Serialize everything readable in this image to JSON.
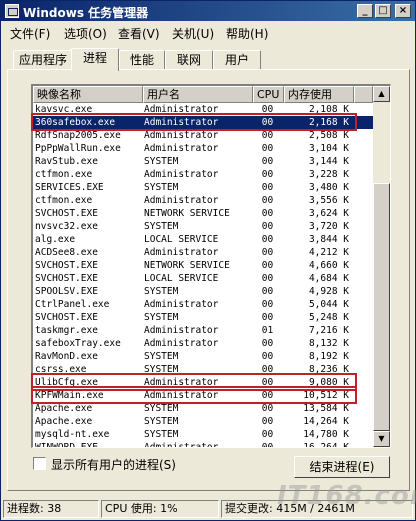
{
  "window": {
    "title": "Windows 任务管理器"
  },
  "titlebar_buttons": {
    "minimize": "_",
    "maximize": "□",
    "close": "×"
  },
  "menu": [
    "文件(F)",
    "选项(O)",
    "查看(V)",
    "关机(U)",
    "帮助(H)"
  ],
  "tabs": [
    "应用程序",
    "进程",
    "性能",
    "联网",
    "用户"
  ],
  "active_tab": "进程",
  "columns": [
    "映像名称",
    "用户名",
    "CPU",
    "内存使用"
  ],
  "processes": [
    {
      "name": "kavsvc.exe",
      "user": "Administrator",
      "cpu": "00",
      "mem": "2,108 K"
    },
    {
      "name": "360safebox.exe",
      "user": "Administrator",
      "cpu": "00",
      "mem": "2,168 K"
    },
    {
      "name": "RdfSnap2005.exe",
      "user": "Administrator",
      "cpu": "00",
      "mem": "2,508 K"
    },
    {
      "name": "PpPpWallRun.exe",
      "user": "Administrator",
      "cpu": "00",
      "mem": "3,104 K"
    },
    {
      "name": "RavStub.exe",
      "user": "SYSTEM",
      "cpu": "00",
      "mem": "3,144 K"
    },
    {
      "name": "ctfmon.exe",
      "user": "Administrator",
      "cpu": "00",
      "mem": "3,228 K"
    },
    {
      "name": "SERVICES.EXE",
      "user": "SYSTEM",
      "cpu": "00",
      "mem": "3,480 K"
    },
    {
      "name": "ctfmon.exe",
      "user": "Administrator",
      "cpu": "00",
      "mem": "3,556 K"
    },
    {
      "name": "SVCHOST.EXE",
      "user": "NETWORK SERVICE",
      "cpu": "00",
      "mem": "3,624 K"
    },
    {
      "name": "nvsvc32.exe",
      "user": "SYSTEM",
      "cpu": "00",
      "mem": "3,720 K"
    },
    {
      "name": "alg.exe",
      "user": "LOCAL SERVICE",
      "cpu": "00",
      "mem": "3,844 K"
    },
    {
      "name": "ACDSee8.exe",
      "user": "Administrator",
      "cpu": "00",
      "mem": "4,212 K"
    },
    {
      "name": "SVCHOST.EXE",
      "user": "NETWORK SERVICE",
      "cpu": "00",
      "mem": "4,660 K"
    },
    {
      "name": "SVCHOST.EXE",
      "user": "LOCAL SERVICE",
      "cpu": "00",
      "mem": "4,684 K"
    },
    {
      "name": "SPOOLSV.EXE",
      "user": "SYSTEM",
      "cpu": "00",
      "mem": "4,928 K"
    },
    {
      "name": "CtrlPanel.exe",
      "user": "Administrator",
      "cpu": "00",
      "mem": "5,044 K"
    },
    {
      "name": "SVCHOST.EXE",
      "user": "SYSTEM",
      "cpu": "00",
      "mem": "5,248 K"
    },
    {
      "name": "taskmgr.exe",
      "user": "Administrator",
      "cpu": "01",
      "mem": "7,216 K"
    },
    {
      "name": "safeboxTray.exe",
      "user": "Administrator",
      "cpu": "00",
      "mem": "8,132 K"
    },
    {
      "name": "RavMonD.exe",
      "user": "SYSTEM",
      "cpu": "00",
      "mem": "8,192 K"
    },
    {
      "name": "csrss.exe",
      "user": "SYSTEM",
      "cpu": "00",
      "mem": "8,236 K"
    },
    {
      "name": "UlibCfg.exe",
      "user": "Administrator",
      "cpu": "00",
      "mem": "9,080 K"
    },
    {
      "name": "KPFWMain.exe",
      "user": "Administrator",
      "cpu": "00",
      "mem": "10,512 K"
    },
    {
      "name": "Apache.exe",
      "user": "SYSTEM",
      "cpu": "00",
      "mem": "13,584 K"
    },
    {
      "name": "Apache.exe",
      "user": "SYSTEM",
      "cpu": "00",
      "mem": "14,264 K"
    },
    {
      "name": "mysqld-nt.exe",
      "user": "SYSTEM",
      "cpu": "00",
      "mem": "14,780 K"
    },
    {
      "name": "WINWORD.EXE",
      "user": "Administrator",
      "cpu": "00",
      "mem": "16,264 K"
    }
  ],
  "selected_row": 1,
  "highlighted_rows": [
    1,
    21,
    22
  ],
  "show_all_users_label": "显示所有用户的进程(S)",
  "show_all_users_checked": false,
  "end_process_button": "结束进程(E)",
  "status": {
    "process_count": "进程数: 38",
    "cpu_usage": "CPU 使用: 1%",
    "commit_charge": "提交更改: 415M / 2461M"
  },
  "watermark": "IT168.com",
  "colors": {
    "titlebar": "#0a246a",
    "selection": "#0a246a",
    "highlight_box": "#c0202a",
    "window_bg": "#ece9d8"
  }
}
